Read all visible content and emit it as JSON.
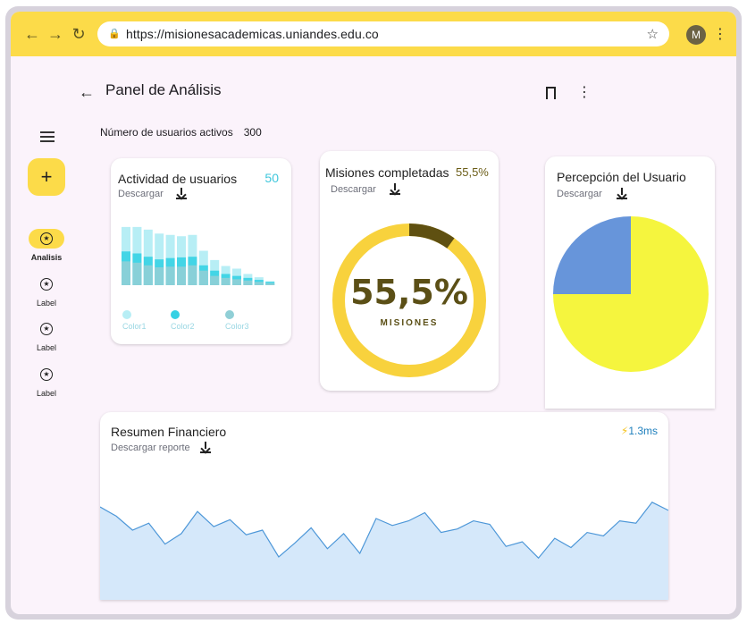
{
  "browser": {
    "url": "https://misionesacademicas.uniandes.edu.co",
    "avatar": "M"
  },
  "page": {
    "title": "Panel de Análisis",
    "users_label": "Número de usuarios activos",
    "users_value": "300"
  },
  "rail": {
    "items": [
      {
        "label": "Analisis"
      },
      {
        "label": "Label"
      },
      {
        "label": "Label"
      },
      {
        "label": "Label"
      }
    ]
  },
  "activity": {
    "title": "Actividad de usuarios",
    "badge": "50",
    "download": "Descargar",
    "legend": [
      "Color1",
      "Color2",
      "Color3"
    ],
    "colors": {
      "c1": "#b7eef5",
      "c2": "#36d1e4",
      "c3": "#90cfd6"
    }
  },
  "missions": {
    "title": "Misiones completadas",
    "pct_label": "55,5%",
    "download": "Descargar",
    "center_value": "55,5%",
    "center_label": "MISIONES",
    "highlight_fraction": 0.1
  },
  "perception": {
    "title": "Percepción del Usuario",
    "download": "Descargar"
  },
  "finance": {
    "title": "Resumen Financiero",
    "download": "Descargar reporte",
    "latency": "1.3ms"
  },
  "chart_data": [
    {
      "type": "bar",
      "title": "Actividad de usuarios",
      "series": [
        {
          "name": "Color1",
          "values": [
            88,
            88,
            84,
            78,
            76,
            74,
            76,
            52,
            38,
            29,
            25,
            17,
            12,
            6
          ]
        },
        {
          "name": "Color2",
          "values": [
            51,
            48,
            43,
            39,
            41,
            42,
            43,
            30,
            22,
            17,
            14,
            11,
            8,
            5
          ]
        },
        {
          "name": "Color3",
          "values": [
            36,
            34,
            30,
            27,
            28,
            28,
            30,
            22,
            14,
            11,
            9,
            7,
            5,
            3
          ]
        }
      ]
    },
    {
      "type": "pie",
      "title": "Misiones completadas",
      "values": [
        10,
        90
      ],
      "colors": [
        "#5f5011",
        "#f8d23d"
      ]
    },
    {
      "type": "pie",
      "title": "Percepción del Usuario",
      "values": [
        75,
        25
      ],
      "colors": [
        "#f5f53e",
        "#6795da"
      ]
    },
    {
      "type": "area",
      "title": "Resumen Financiero",
      "values": [
        80,
        72,
        60,
        66,
        48,
        57,
        76,
        63,
        69,
        56,
        60,
        37,
        49,
        62,
        44,
        57,
        40,
        70,
        64,
        68,
        75,
        58,
        61,
        68,
        65,
        46,
        50,
        36,
        53,
        45,
        58,
        55,
        68,
        66,
        84,
        77
      ]
    }
  ]
}
